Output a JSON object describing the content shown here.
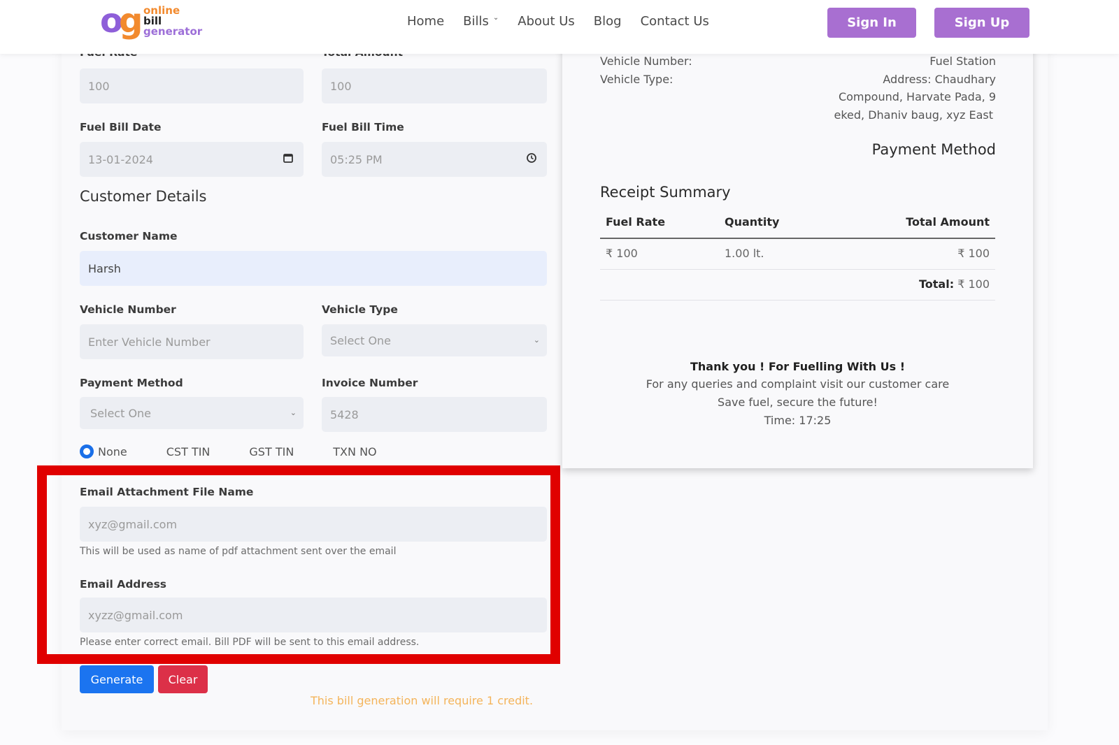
{
  "header": {
    "logo": {
      "mark_o": "o",
      "mark_g": "g",
      "line1": "online",
      "line2": "bill",
      "line3": "generator"
    },
    "nav": [
      {
        "label": "Home"
      },
      {
        "label": "Bills",
        "has_dropdown": true,
        "dropdown_icon": "chevron-down-icon"
      },
      {
        "label": "About Us"
      },
      {
        "label": "Blog"
      },
      {
        "label": "Contact Us"
      }
    ],
    "sign_in": "Sign In",
    "sign_up": "Sign Up",
    "accent_color": "#a86fd1"
  },
  "form": {
    "fuel_rate": {
      "label": "Fuel Rate",
      "value": "100"
    },
    "total_amount": {
      "label": "Total Amount",
      "value": "100"
    },
    "fuel_bill_date": {
      "label": "Fuel Bill Date",
      "value": "13-01-2024",
      "icon": "calendar-icon"
    },
    "fuel_bill_time": {
      "label": "Fuel Bill Time",
      "value": "05:25 PM",
      "icon": "clock-icon"
    },
    "customer_section_title": "Customer Details",
    "customer_name": {
      "label": "Customer Name",
      "value": "Harsh"
    },
    "vehicle_number": {
      "label": "Vehicle Number",
      "placeholder": "Enter Vehicle Number"
    },
    "vehicle_type": {
      "label": "Vehicle Type",
      "selected": "Select One"
    },
    "payment_method": {
      "label": "Payment Method",
      "selected": "Select One"
    },
    "invoice_number": {
      "label": "Invoice Number",
      "value": "5428"
    },
    "tax_options": [
      {
        "label": "None",
        "checked": true
      },
      {
        "label": "CST TIN",
        "checked": false
      },
      {
        "label": "GST TIN",
        "checked": false
      },
      {
        "label": "TXN NO",
        "checked": false
      }
    ],
    "email_attachment": {
      "label": "Email Attachment File Name",
      "placeholder": "xyz@gmail.com",
      "help": "This will be used as name of pdf attachment sent over the email"
    },
    "email_address": {
      "label": "Email Address",
      "placeholder": "xyzz@gmail.com",
      "help": "Please enter correct email. Bill PDF will be sent to this email address."
    },
    "generate_label": "Generate",
    "clear_label": "Clear",
    "credit_note": "This bill generation will require 1 credit.",
    "colors": {
      "generate": "#1b74f0",
      "clear": "#dc3048",
      "highlight": "#e00000",
      "credit_note": "#f4b45a"
    }
  },
  "receipt": {
    "vehicle_number_label": "Vehicle Number:",
    "vehicle_type_label": "Vehicle Type:",
    "station_name": "Fuel Station",
    "address_lines": [
      "Address: Chaudhary",
      "Compound, Harvate Pada, 9",
      "eked, Dhaniv baug, xyz East"
    ],
    "payment_method_heading": "Payment Method",
    "summary_heading": "Receipt Summary",
    "table": {
      "headers": [
        "Fuel Rate",
        "Quantity",
        "Total Amount"
      ],
      "rows": [
        [
          "₹ 100",
          "1.00 lt.",
          "₹ 100"
        ]
      ],
      "total_label": "Total:",
      "total_value": "₹ 100"
    },
    "thank_you": "Thank you ! For Fuelling With Us !",
    "queries": "For any queries and complaint visit our customer care",
    "slogan": "Save fuel, secure the future!",
    "time": "Time: 17:25"
  }
}
